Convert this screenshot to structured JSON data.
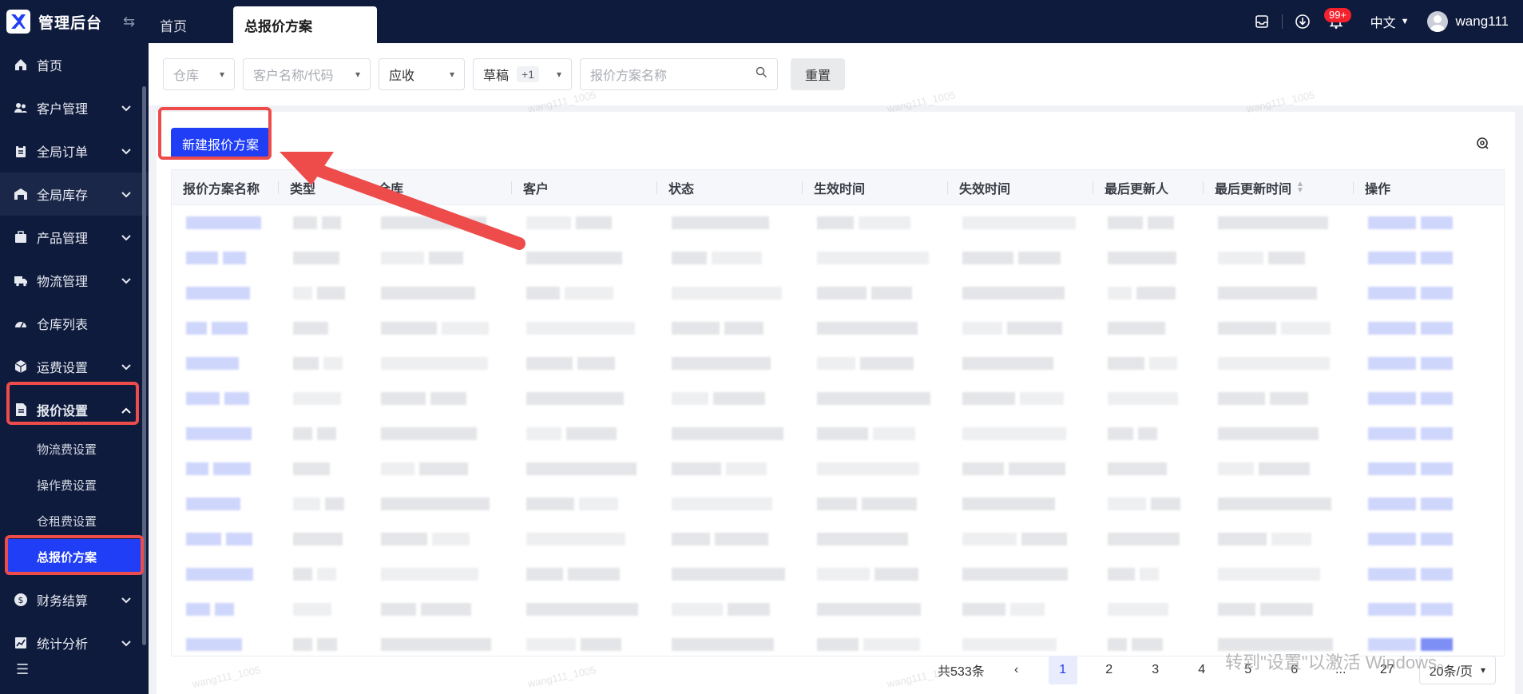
{
  "app": {
    "title": "管理后台",
    "tabs": [
      "首页",
      "总报价方案"
    ]
  },
  "topbar": {
    "notif_badge": "99+",
    "language": "中文",
    "username": "wang111"
  },
  "sidebar": {
    "items": [
      {
        "label": "首页",
        "icon": "home-icon"
      },
      {
        "label": "客户管理",
        "icon": "users-icon"
      },
      {
        "label": "全局订单",
        "icon": "clipboard-icon"
      },
      {
        "label": "全局库存",
        "icon": "warehouse-icon"
      },
      {
        "label": "产品管理",
        "icon": "box-icon"
      },
      {
        "label": "物流管理",
        "icon": "truck-icon"
      },
      {
        "label": "仓库列表",
        "icon": "gauge-icon"
      },
      {
        "label": "运费设置",
        "icon": "cube-icon"
      },
      {
        "label": "报价设置",
        "icon": "doc-icon"
      },
      {
        "label": "财务结算",
        "icon": "coin-icon"
      },
      {
        "label": "统计分析",
        "icon": "chart-icon"
      }
    ],
    "subitems": [
      "物流费设置",
      "操作费设置",
      "仓租费设置",
      "总报价方案"
    ]
  },
  "filters": {
    "warehouse_ph": "仓库",
    "customer_ph": "客户名称/代码",
    "receivable": "应收",
    "status": "草稿",
    "status_extra": "+1",
    "plan_name_ph": "报价方案名称",
    "reset": "重置"
  },
  "actions": {
    "new_plan": "新建报价方案"
  },
  "table": {
    "columns": [
      "报价方案名称",
      "类型",
      "仓库",
      "客户",
      "状态",
      "生效时间",
      "失效时间",
      "最后更新人",
      "最后更新时间",
      "操作"
    ]
  },
  "pagination": {
    "total": "共533条",
    "pages": [
      "1",
      "2",
      "3",
      "4",
      "5",
      "6",
      "...",
      "27"
    ],
    "page_size": "20条/页"
  },
  "os_watermark": "转到\"设置\"以激活 Windows。",
  "user_watermark": "wang111_1005"
}
